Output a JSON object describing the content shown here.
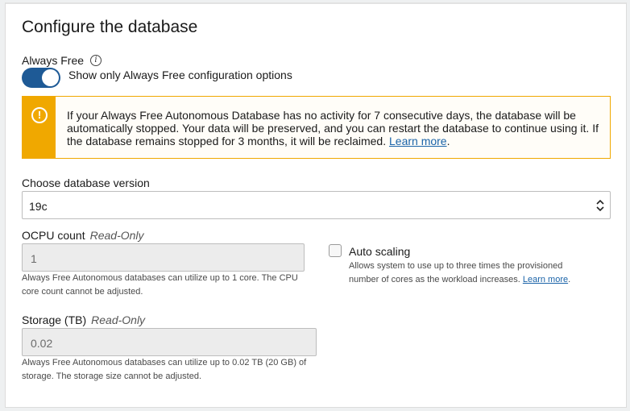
{
  "title": "Configure the database",
  "always_free": {
    "label": "Always Free",
    "toggle_on": true,
    "toggle_label": "Show only Always Free configuration options"
  },
  "alert": {
    "message": "If your Always Free Autonomous Database has no activity for 7 consecutive days, the database will be automatically stopped. Your data will be preserved, and you can restart the database to continue using it. If the database remains stopped for 3 months, it will be reclaimed.",
    "link": "Learn more",
    "suffix": ".",
    "color": "#f0a800"
  },
  "version": {
    "label": "Choose database version",
    "value": "19c"
  },
  "ocpu": {
    "label": "OCPU count",
    "readonly": "Read-Only",
    "value": "1",
    "help": "Always Free Autonomous databases can utilize up to 1 core. The CPU core count cannot be adjusted."
  },
  "auto_scaling": {
    "label": "Auto scaling",
    "checked": false,
    "help": "Allows system to use up to three times the provisioned number of cores as the workload increases.",
    "link": "Learn more",
    "suffix": "."
  },
  "storage": {
    "label": "Storage (TB)",
    "readonly": "Read-Only",
    "value": "0.02",
    "help": "Always Free Autonomous databases can utilize up to 0.02 TB (20 GB) of storage. The storage size cannot be adjusted."
  },
  "colors": {
    "toggle": "#1e5a96",
    "link": "#1a63a8"
  }
}
